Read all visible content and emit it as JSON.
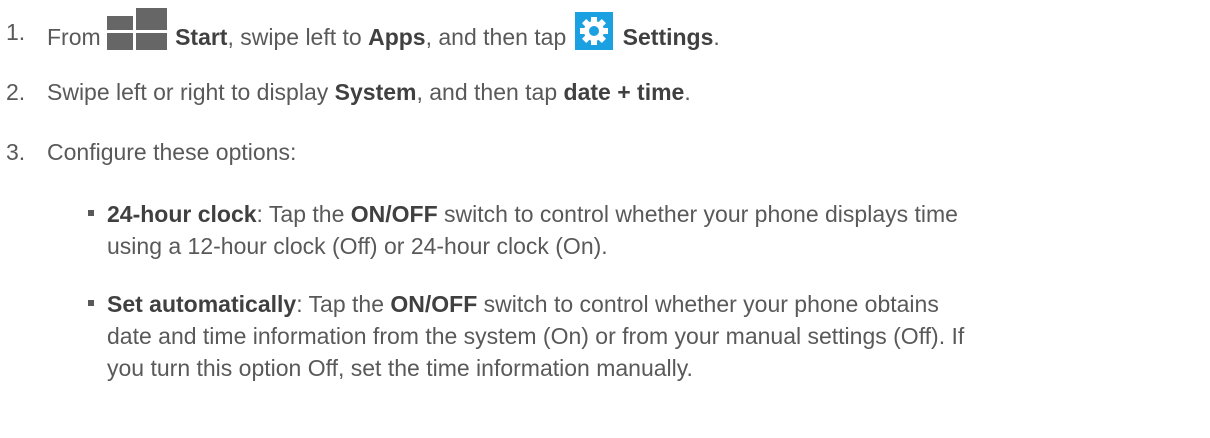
{
  "steps": [
    {
      "number": "1.",
      "t1": "From ",
      "b1": "Start",
      "t2": ", swipe left to ",
      "b2": "Apps",
      "t3": ", and then tap ",
      "b3": "Settings",
      "t4": ".",
      "icons": [
        "windows-start-icon",
        "settings-gear-icon"
      ]
    },
    {
      "number": "2.",
      "t1": "Swipe left or right to display ",
      "b1": "System",
      "t2": ", and then tap ",
      "b2": "date + time",
      "t3": "."
    },
    {
      "number": "3.",
      "t1": "Configure these options:"
    }
  ],
  "options": [
    {
      "label": "24-hour clock",
      "l1_a": ": Tap the ",
      "l1_b": "ON/OFF",
      "l1_c": " switch to control whether your phone displays time",
      "l2": "using a 12-hour clock (Off) or 24-hour clock (On)."
    },
    {
      "label": "Set automatically",
      "l1_a": ": Tap the ",
      "l1_b": "ON/OFF",
      "l1_c": " switch to control whether your phone obtains",
      "l2": "date and time information from the system (On) or from your manual settings (Off). If",
      "l3": "you turn this option Off, set the time information manually."
    }
  ],
  "colors": {
    "text": "#595959",
    "bold": "#404040",
    "start_tile": "#666666",
    "settings_tile": "#1ba1e2"
  }
}
